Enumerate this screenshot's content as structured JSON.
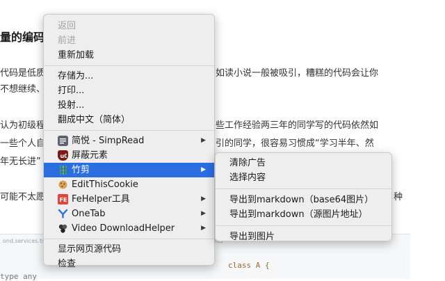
{
  "article": {
    "heading": "量的编码",
    "fragments": {
      "line1_left": "代码是低质",
      "line1_right": "如读小说一般被吸引，糟糕的代码会让你",
      "line2_left": "不想继续、",
      "line3_left": "认为初级程",
      "line3_right": "些工作经验两三年的同学写的代码依然如",
      "line4_left": "一些个人自",
      "line4_right": "引的同学，很容易习惯成“学习半年、然",
      "line5_left": "年无长进”",
      "line6_left": "可能不太愿",
      "line6_right": "种"
    },
    "code": {
      "tab_left": "ond.services.ts",
      "tab_right": "nts",
      "line_right": "class A {",
      "line_left": "type any",
      "line_right2": ""
    }
  },
  "context_menu": {
    "items": [
      {
        "label": "返回",
        "disabled": true
      },
      {
        "label": "前进",
        "disabled": true
      },
      {
        "label": "重新加载"
      },
      {
        "label": "存储为..."
      },
      {
        "label": "打印..."
      },
      {
        "label": "投射..."
      },
      {
        "label": "翻成中文（简体）"
      },
      {
        "label": "简悦 - SimpRead",
        "icon": "simpread-icon",
        "submenu": true
      },
      {
        "label": "屏蔽元素",
        "icon": "ublock-icon"
      },
      {
        "label": "竹剪",
        "icon": "zhujian-icon",
        "submenu": true,
        "active": true
      },
      {
        "label": "EditThisCookie",
        "icon": "cookie-icon"
      },
      {
        "label": "FeHelper工具",
        "icon": "fehelper-icon",
        "submenu": true
      },
      {
        "label": "OneTab",
        "icon": "onetab-icon",
        "submenu": true
      },
      {
        "label": "Video DownloadHelper",
        "icon": "video-downloadhelper-icon",
        "submenu": true
      },
      {
        "label": "显示网页源代码"
      },
      {
        "label": "检查"
      }
    ],
    "arrow_glyph": "▶"
  },
  "submenu": {
    "items": [
      {
        "label": "清除广告"
      },
      {
        "label": "选择内容"
      },
      {
        "label": "导出到markdown（base64图片）"
      },
      {
        "label": "导出到markdown（源图片地址）"
      },
      {
        "label": "导出到图片"
      }
    ]
  },
  "colors": {
    "highlight": "#2a6ee2",
    "menu_bg": "#eeeeee",
    "disabled_text": "#a3a3a3"
  }
}
